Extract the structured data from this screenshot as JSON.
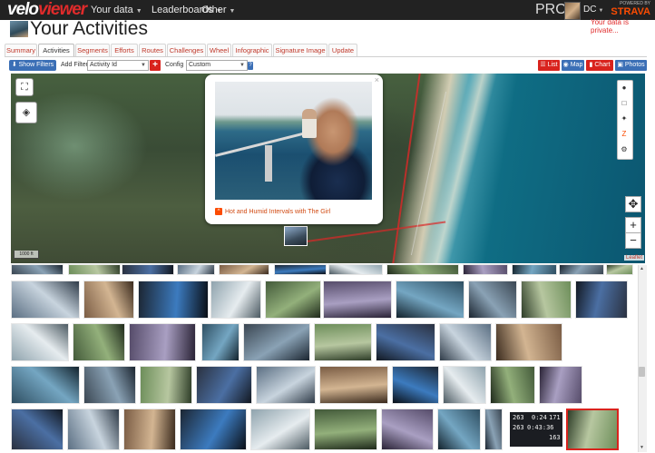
{
  "colors": {
    "nav_bg": "#222222",
    "brand_red": "#e02b2b",
    "strava_orange": "#fc4c02",
    "filter_blue": "#3b6fb6",
    "tab_text": "#c0392b"
  },
  "brand": {
    "logo_a": "velo",
    "logo_b": "viewer"
  },
  "topnav": {
    "items": [
      "Your data",
      "Leaderboards",
      "Other"
    ],
    "pro": "PRO",
    "user": "DC",
    "powered_by": "POWERED BY",
    "strava": "STRAVA",
    "private_note": "Your data is private..."
  },
  "page": {
    "title": "Your Activities"
  },
  "tabs": [
    "Summary",
    "Activities",
    "Segments",
    "Efforts",
    "Routes",
    "Challenges",
    "Wheel",
    "Infographic",
    "Signature Image",
    "Update"
  ],
  "active_tab": "Activities",
  "filterbar": {
    "show_filters": "Show Filters",
    "add_filter_label": "Add Filter",
    "add_filter_value": "Activity Id",
    "config_label": "Config",
    "config_value": "Custom",
    "views": [
      "List",
      "Map",
      "Chart",
      "Photos"
    ]
  },
  "map": {
    "scale": "1000 ft",
    "attribution": "Leaflet",
    "popup_title": "Hot and Humid Intervals with The Girl"
  },
  "gallery": {
    "timer_values": [
      "263",
      "0:24",
      "171",
      "263",
      "0:43:36",
      "163"
    ]
  },
  "icons": [
    "caret-down-icon",
    "fullscreen-icon",
    "layers-icon",
    "camera-icon",
    "square-icon",
    "pin-icon",
    "strava-icon",
    "settings-icon",
    "locate-icon",
    "zoom-in-icon",
    "zoom-out-icon",
    "close-icon",
    "plus-icon",
    "help-icon"
  ]
}
